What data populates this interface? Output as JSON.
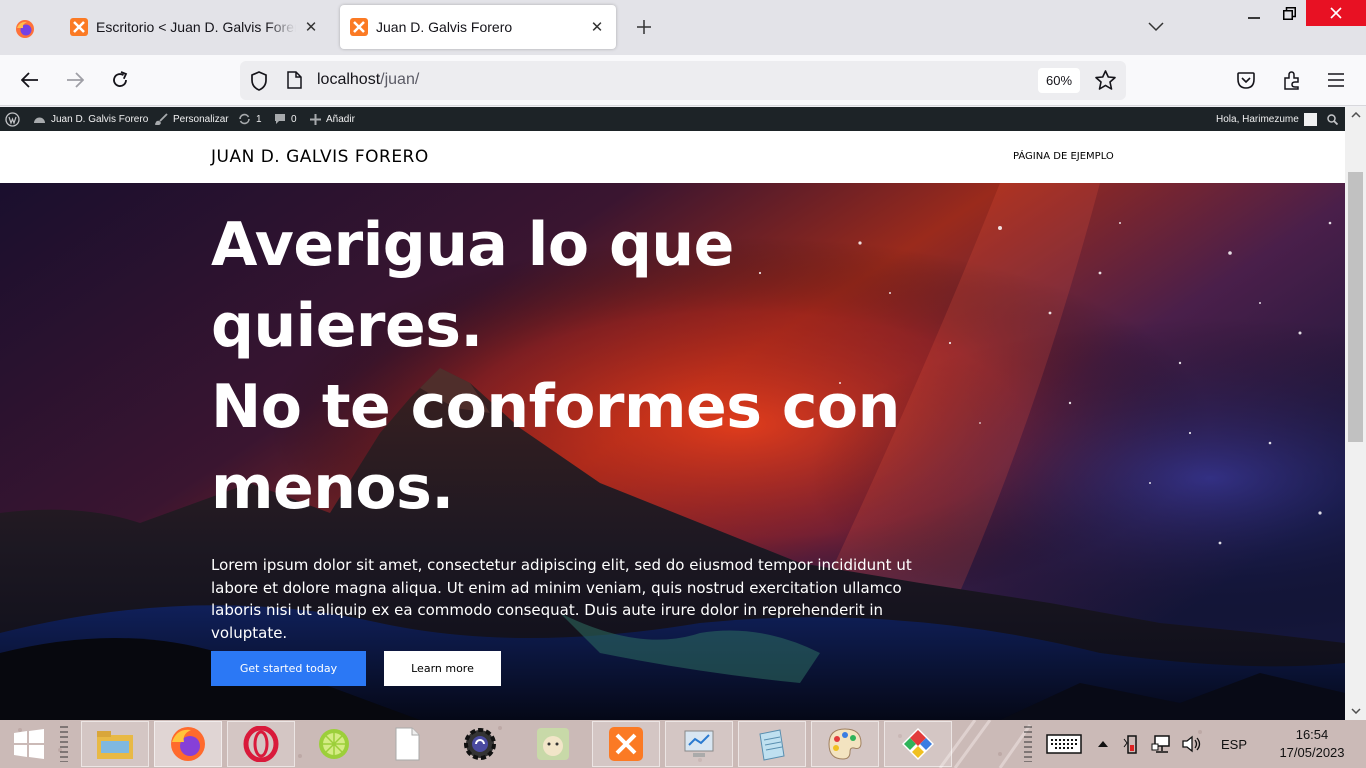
{
  "browser": {
    "tabs": [
      {
        "title": "Escritorio < Juan D. Galvis Forero — WordPress",
        "active": false
      },
      {
        "title": "Juan D. Galvis Forero",
        "active": true
      }
    ],
    "url_host": "localhost",
    "url_path": "/juan/",
    "zoom": "60%"
  },
  "wp_admin_bar": {
    "site_name": "Juan D. Galvis Forero",
    "customize": "Personalizar",
    "updates": "1",
    "comments": "0",
    "add_new": "Añadir",
    "greeting": "Hola, Harimezume"
  },
  "site": {
    "title": "JUAN D. GALVIS FORERO",
    "nav_item": "PÁGINA DE EJEMPLO"
  },
  "hero": {
    "title_lines": [
      "Averigua lo que",
      "quieres.",
      "No te conformes con",
      "menos."
    ],
    "paragraph": "Lorem ipsum dolor sit amet, consectetur adipiscing elit, sed do eiusmod tempor incididunt ut labore et dolore magna aliqua. Ut enim ad minim veniam, quis nostrud exercitation ullamco laboris nisi ut aliquip ex ea commodo consequat. Duis aute irure dolor in reprehenderit in voluptate.",
    "primary_button": "Get started today",
    "secondary_button": "Learn more"
  },
  "taskbar": {
    "apps": [
      "file-explorer",
      "firefox",
      "opera",
      "lime-app",
      "blank-document",
      "gear-app",
      "character-app",
      "xampp",
      "monitor-app",
      "notepad-app",
      "paint-app",
      "color-tiles-app"
    ],
    "language": "ESP",
    "time": "16:54",
    "date": "17/05/2023"
  },
  "colors": {
    "accent_button": "#2b78f5",
    "wp_bar": "#1d2327",
    "close_button": "#e81123"
  }
}
